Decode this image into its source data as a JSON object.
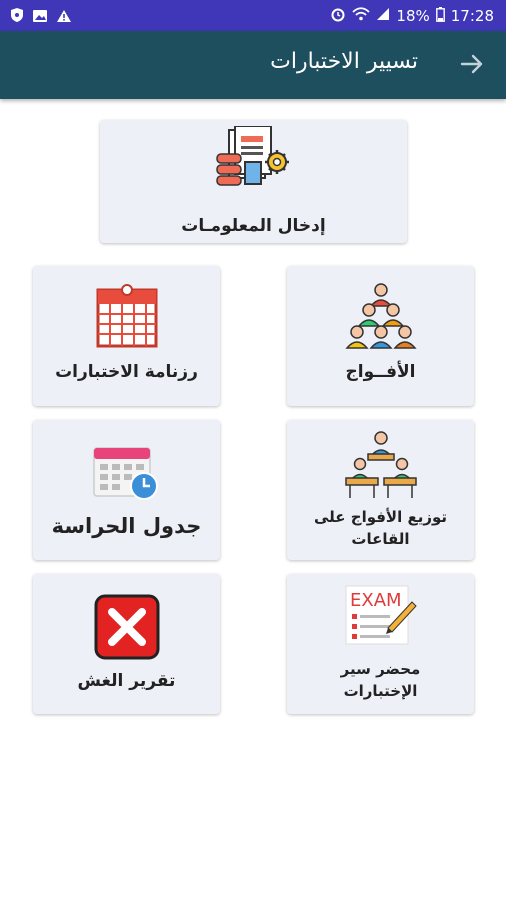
{
  "status": {
    "battery": "18%",
    "time": "17:28"
  },
  "appbar": {
    "title": "تسيير الاختبارات"
  },
  "cards": {
    "data_entry": "إدخال المعلومـات",
    "exam_calendar": "رزنامة الاختبارات",
    "groups": "الأفــواج",
    "guard_schedule": "جدول الحراسة",
    "groups_distribution_l1": "توزيع الأفواج على",
    "groups_distribution_l2": "القاعات",
    "cheating_report": "تقرير الغش",
    "exam_minutes_l1": "محضر سير",
    "exam_minutes_l2": "الإختبارات"
  },
  "icons": {
    "data_entry": "documents-gear-icon",
    "calendar": "calendar-icon",
    "groups": "people-pyramid-icon",
    "schedule": "calendar-clock-icon",
    "classroom": "classroom-icon",
    "report": "red-x-icon",
    "exam": "exam-sheet-icon"
  },
  "colors": {
    "statusbar": "#3f36b8",
    "appbar": "#1e4f5e",
    "card": "#eef0f7"
  }
}
